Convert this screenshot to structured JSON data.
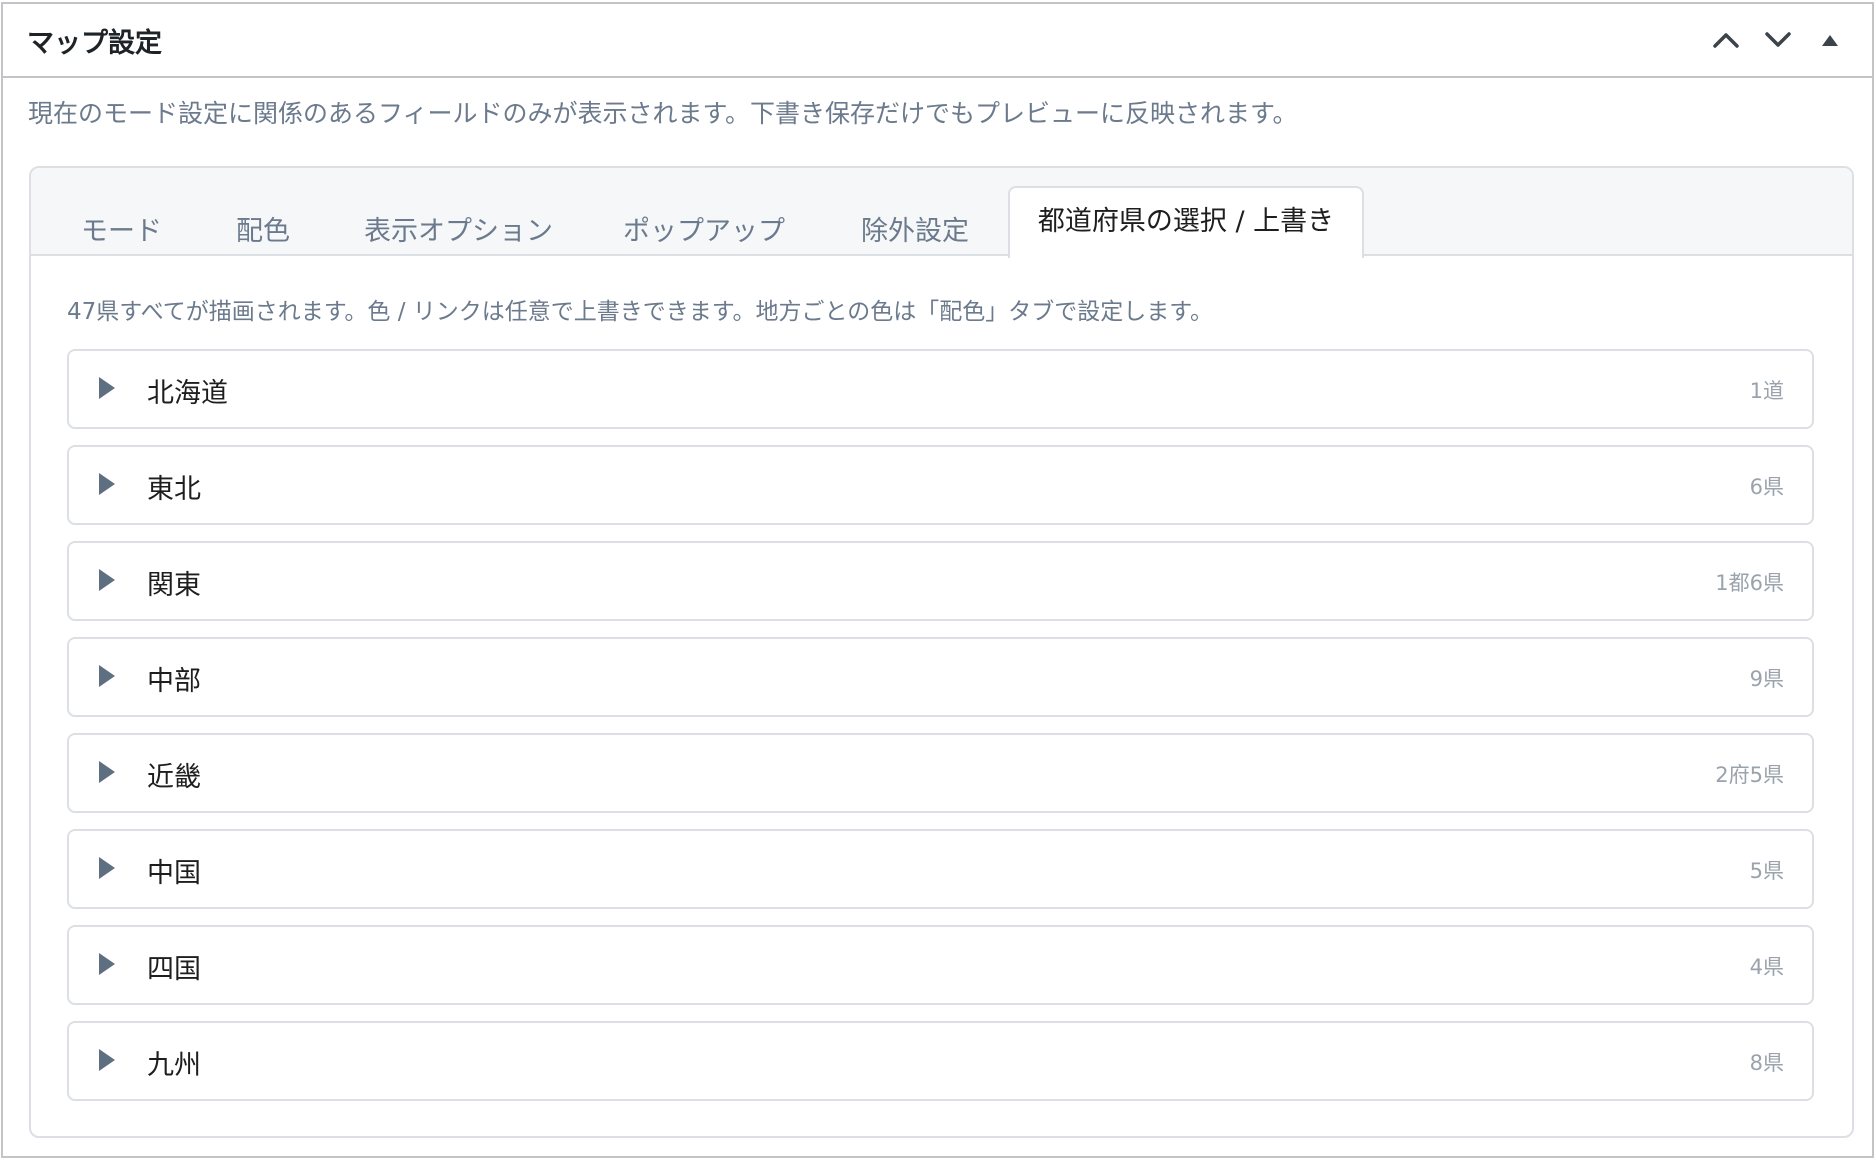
{
  "metabox": {
    "title": "マップ設定",
    "controls": [
      "chevron-up-icon",
      "chevron-down-icon",
      "triangle-up-icon"
    ]
  },
  "description": "現在のモード設定に関係のあるフィールドのみが表示されます。下書き保存だけでもプレビューに反映されます。",
  "tabs": [
    {
      "label": "モード",
      "active": false
    },
    {
      "label": "配色",
      "active": false
    },
    {
      "label": "表示オプション",
      "active": false
    },
    {
      "label": "ポップアップ",
      "active": false
    },
    {
      "label": "除外設定",
      "active": false
    },
    {
      "label": "都道府県の選択 / 上書き",
      "active": true
    }
  ],
  "tab_note": "47県すべてが描画されます。色 / リンクは任意で上書きできます。地方ごとの色は「配色」タブで設定します。",
  "regions": [
    {
      "name": "北海道",
      "count": "1道"
    },
    {
      "name": "東北",
      "count": "6県"
    },
    {
      "name": "関東",
      "count": "1都6県"
    },
    {
      "name": "中部",
      "count": "9県"
    },
    {
      "name": "近畿",
      "count": "2府5県"
    },
    {
      "name": "中国",
      "count": "5県"
    },
    {
      "name": "四国",
      "count": "4県"
    },
    {
      "name": "九州",
      "count": "8県"
    }
  ],
  "colors": {
    "border": "#c3c4c7",
    "panel_border": "#dcdfe4",
    "muted_text": "#6b7a8c",
    "count_text": "#9aa3ad",
    "triangle": "#5f6f82"
  }
}
